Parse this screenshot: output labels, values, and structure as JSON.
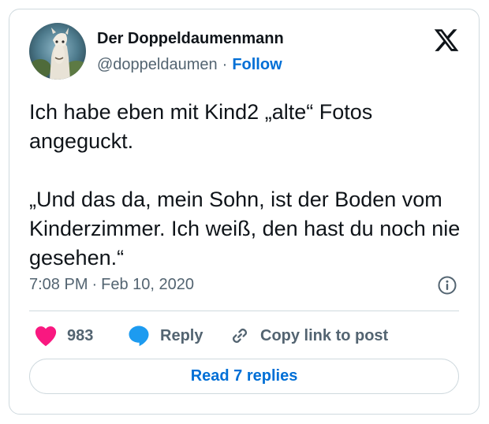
{
  "author": {
    "display_name": "Der Doppeldaumenmann",
    "handle": "@doppeldaumen",
    "separator": "·",
    "follow_label": "Follow"
  },
  "tweet": {
    "text": "Ich habe eben mit Kind2 „alte“ Fotos angeguckt.\n\n„Und das da, mein Sohn, ist der Boden vom Kinderzimmer. Ich weiß, den hast du noch nie gesehen.“",
    "time": "7:08 PM",
    "separator": "·",
    "date": "Feb 10, 2020"
  },
  "actions": {
    "like_count": "983",
    "reply_label": "Reply",
    "copy_link_label": "Copy link to post"
  },
  "read_replies_label": "Read 7 replies",
  "icons": {
    "logo": "x-logo-icon",
    "info": "info-icon",
    "like": "heart-icon",
    "reply": "speech-bubble-icon",
    "copy": "link-icon"
  },
  "colors": {
    "text": "#0f1419",
    "secondary": "#536471",
    "link": "#006fd6",
    "like": "#f91880",
    "reply": "#1d9bf0",
    "border": "#cfd9de"
  }
}
